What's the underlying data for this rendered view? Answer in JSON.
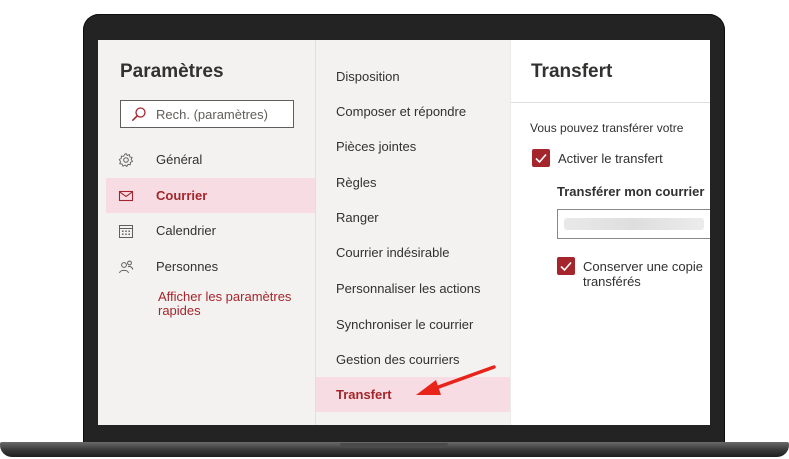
{
  "settings": {
    "title": "Paramètres",
    "search_placeholder": "Rech. (paramètres)",
    "items": [
      {
        "label": "Général",
        "icon": "gear-icon",
        "selected": false
      },
      {
        "label": "Courrier",
        "icon": "mail-icon",
        "selected": true
      },
      {
        "label": "Calendrier",
        "icon": "calendar-icon",
        "selected": false
      },
      {
        "label": "Personnes",
        "icon": "people-icon",
        "selected": false
      }
    ],
    "quick_settings_link": "Afficher les paramètres rapides"
  },
  "mail_options": {
    "items": [
      {
        "label": "Disposition"
      },
      {
        "label": "Composer et répondre"
      },
      {
        "label": "Pièces jointes"
      },
      {
        "label": "Règles"
      },
      {
        "label": "Ranger"
      },
      {
        "label": "Courrier indésirable"
      },
      {
        "label": "Personnaliser les actions"
      },
      {
        "label": "Synchroniser le courrier"
      },
      {
        "label": "Gestion des courriers"
      },
      {
        "label": "Transfert",
        "selected": true
      }
    ]
  },
  "forwarding": {
    "title": "Transfert",
    "intro": "Vous pouvez transférer votre",
    "enable_label": "Activer le transfert",
    "enable_checked": true,
    "forward_to_label": "Transférer mon courrier",
    "keep_copy_label_line1": "Conserver une copie",
    "keep_copy_label_line2": "transférés",
    "keep_copy_checked": true
  },
  "colors": {
    "accent": "#a4262c",
    "selected_bg": "#f7dde3",
    "pane_bg": "#f3f2f1",
    "annotation_arrow": "#e8231a"
  }
}
